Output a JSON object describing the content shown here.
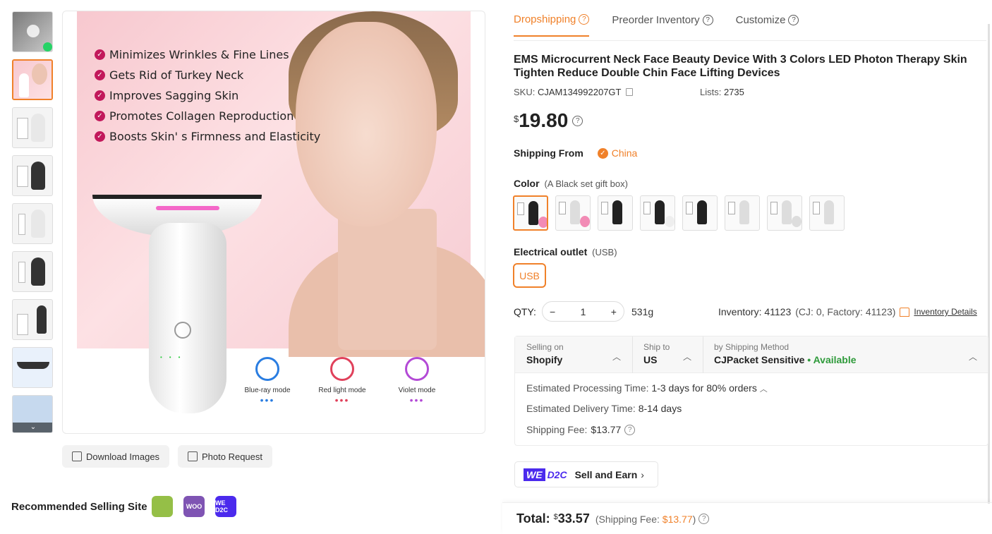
{
  "gallery": {
    "thumbnails": [
      "video-thumb",
      "thumb-2",
      "thumb-3",
      "thumb-4",
      "thumb-5",
      "thumb-6",
      "thumb-7",
      "thumb-8",
      "thumb-9"
    ],
    "features": [
      "Minimizes Wrinkles & Fine Lines",
      "Gets Rid of Turkey Neck",
      "Improves Sagging Skin",
      "Promotes Collagen Reproduction",
      "Boosts Skin' s Firmness and Elasticity"
    ],
    "modes": [
      {
        "label": "Blue-ray mode",
        "color": "#2a7de1"
      },
      {
        "label": "Red light mode",
        "color": "#e0415b"
      },
      {
        "label": "Violet mode",
        "color": "#b34ad6"
      }
    ],
    "download_label": "Download Images",
    "photo_request_label": "Photo Request"
  },
  "recommended": {
    "label": "Recommended Selling Site",
    "sites": [
      {
        "icon": "shopify-icon",
        "color": "#95bf47",
        "text": ""
      },
      {
        "icon": "woo-icon",
        "color": "#7f54b3",
        "text": "WOO"
      },
      {
        "icon": "we-d2c-icon",
        "color": "#4b2aed",
        "text": "WE D2C"
      }
    ]
  },
  "tabs": [
    {
      "label": "Dropshipping",
      "active": true
    },
    {
      "label": "Preorder Inventory",
      "active": false
    },
    {
      "label": "Customize",
      "active": false
    }
  ],
  "product": {
    "title": "EMS Microcurrent Neck Face Beauty Device With 3 Colors LED Photon Therapy Skin Tighten Reduce Double Chin Face Lifting Devices",
    "sku_label": "SKU:",
    "sku": "CJAM134992207GT",
    "lists_label": "Lists:",
    "lists": "2735",
    "currency": "$",
    "price": "19.80",
    "shipping_from_label": "Shipping From",
    "shipping_from": "China",
    "color_label": "Color",
    "color_value": "(A Black set gift box)",
    "outlet_label": "Electrical outlet",
    "outlet_value": "(USB)",
    "outlet_option": "USB",
    "qty_label": "QTY:",
    "qty": "1",
    "weight": "531g",
    "inventory_text": "Inventory: 41123",
    "inventory_detail": "(CJ: 0, Factory: 41123)",
    "inventory_link": "Inventory Details"
  },
  "shipping": {
    "selling_on_label": "Selling on",
    "selling_on": "Shopify",
    "ship_to_label": "Ship to",
    "ship_to": "US",
    "method_label": "by Shipping Method",
    "method": "CJPacket Sensitive",
    "availability": "• Available",
    "processing_label": "Estimated Processing Time:",
    "processing": "1-3 days for 80% orders",
    "delivery_label": "Estimated Delivery Time:",
    "delivery": "8-14 days",
    "fee_label": "Shipping Fee:",
    "fee": "$13.77"
  },
  "sell_earn": {
    "badge_we": "WE",
    "badge_d2c": "D2C",
    "label": "Sell and Earn"
  },
  "total": {
    "label": "Total:",
    "currency": "$",
    "amount": "33.57",
    "fee_prefix": "(Shipping Fee:",
    "fee": "$13.77",
    "fee_suffix": ")"
  },
  "colors": {
    "accent": "#f0812a",
    "available": "#2e9a3a"
  }
}
